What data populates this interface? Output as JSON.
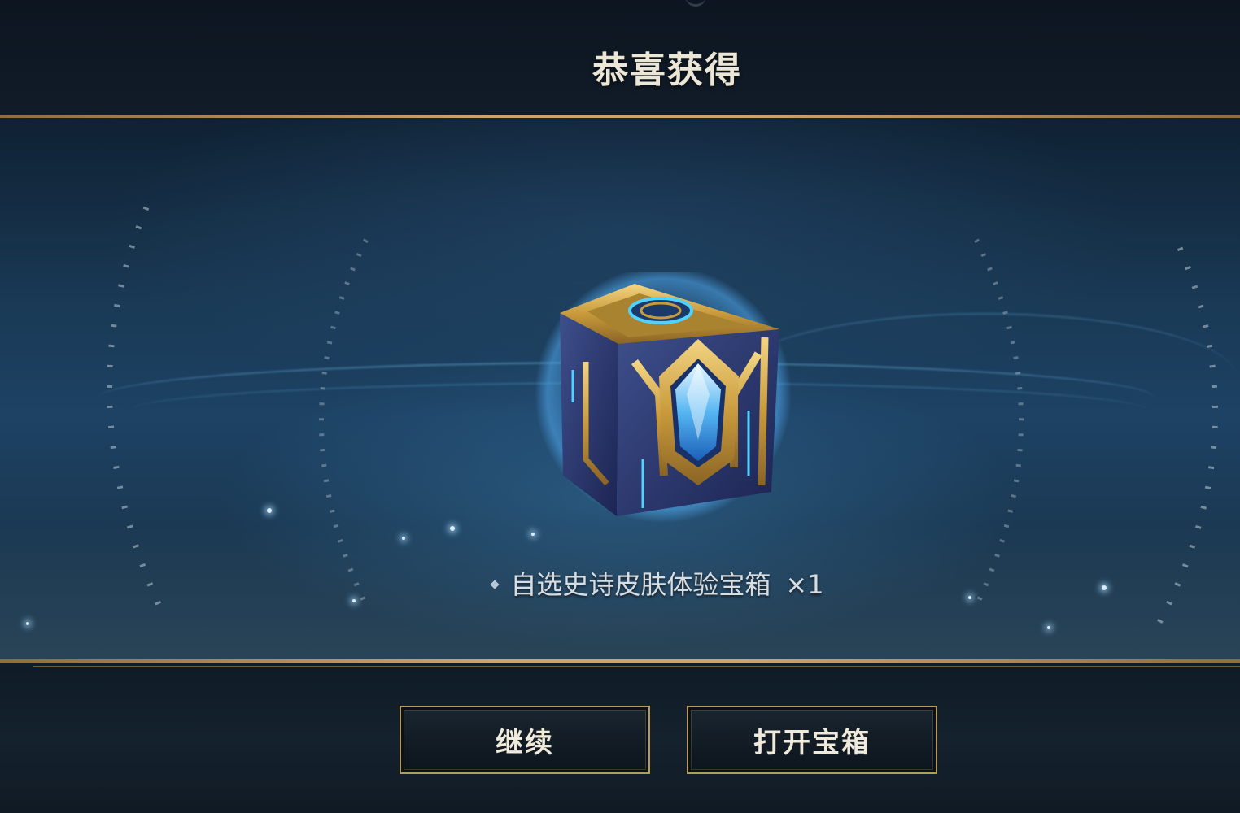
{
  "header": {
    "title": "恭喜获得"
  },
  "reward": {
    "item_name": "自选史诗皮肤体验宝箱",
    "quantity": "×1",
    "icon": "treasure-chest-icon"
  },
  "actions": {
    "continue_label": "继续",
    "open_chest_label": "打开宝箱"
  },
  "colors": {
    "gold_accent": "#c9a866",
    "button_border": "#b89a5c",
    "title_text": "#ece6d6",
    "panel_blue": "#1d4264"
  }
}
